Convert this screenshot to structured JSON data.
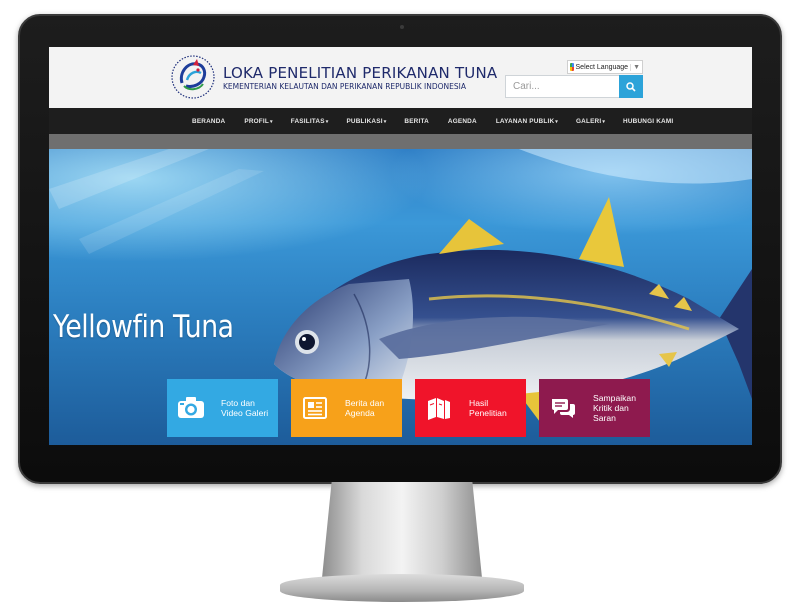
{
  "site": {
    "title": "LOKA PENELITIAN PERIKANAN TUNA",
    "subtitle": "KEMENTERIAN KELAUTAN DAN PERIKANAN REPUBLIK INDONESIA"
  },
  "language": {
    "label": "Select Language",
    "caret": "▼"
  },
  "search": {
    "placeholder": "Cari..."
  },
  "nav": {
    "items": [
      {
        "label": "BERANDA",
        "dropdown": ""
      },
      {
        "label": "PROFIL",
        "dropdown": "▾"
      },
      {
        "label": "FASILITAS",
        "dropdown": "▾"
      },
      {
        "label": "PUBLIKASI",
        "dropdown": "▾"
      },
      {
        "label": "BERITA",
        "dropdown": ""
      },
      {
        "label": "AGENDA",
        "dropdown": ""
      },
      {
        "label": "LAYANAN PUBLIK",
        "dropdown": "▾"
      },
      {
        "label": "GALERI",
        "dropdown": "▾"
      },
      {
        "label": "HUBUNGI KAMI",
        "dropdown": ""
      }
    ]
  },
  "hero": {
    "title": "Yellowfin Tuna"
  },
  "tiles": [
    {
      "label": "Foto dan Video Galeri",
      "icon": "camera-icon",
      "color": "#33a9e3"
    },
    {
      "label": "Berita dan Agenda",
      "icon": "newspaper-icon",
      "color": "#f7a11a"
    },
    {
      "label": "Hasil Penelitian",
      "icon": "books-icon",
      "color": "#f0142a"
    },
    {
      "label": "Sampaikan Kritik dan Saran",
      "icon": "chat-icon",
      "color": "#8e1a4e"
    }
  ]
}
